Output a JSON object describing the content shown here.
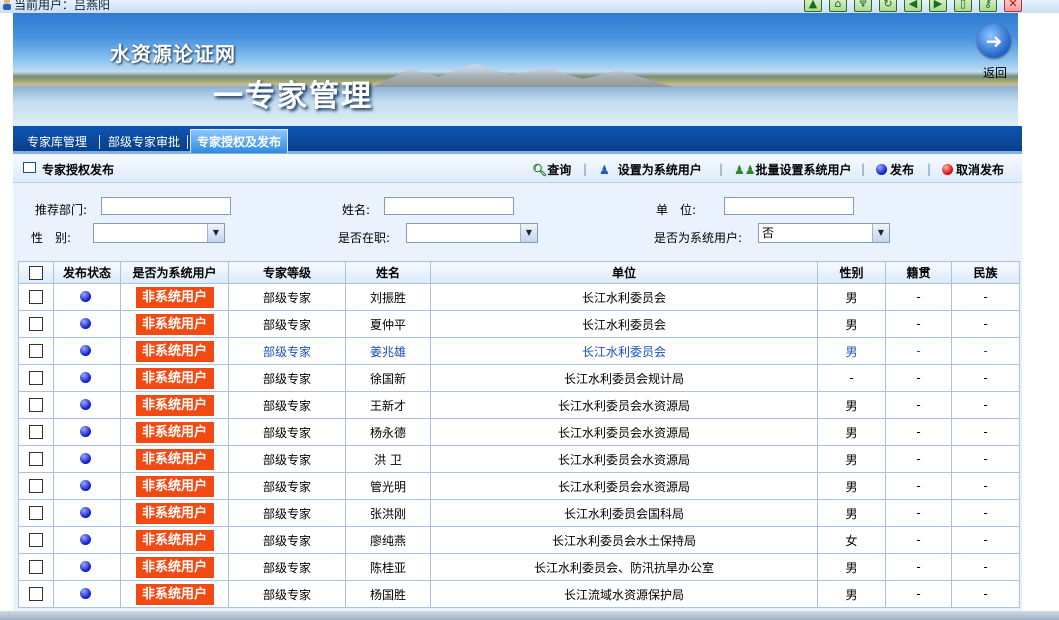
{
  "header": {
    "current_user": "当前用户：吕燕阳",
    "icons": [
      "up-arrow-icon",
      "home-icon",
      "tree-icon",
      "refresh-icon",
      "back-arrow-icon",
      "forward-arrow-icon",
      "exit-icon",
      "key-icon",
      "close-icon"
    ]
  },
  "banner": {
    "title1": "水资源论证网",
    "title2": "一专家管理",
    "back_label": "返回"
  },
  "tabs": [
    {
      "label": "专家库管理"
    },
    {
      "label": "部级专家审批"
    },
    {
      "label": "专家授权及发布"
    }
  ],
  "toolbar": {
    "title": "专家授权发布",
    "query": "查询",
    "set_system_user": "设置为系统用户",
    "batch_set": "批量设置系统用户",
    "publish": "发布",
    "unpublish": "取消发布"
  },
  "filters": {
    "dept_label": "推荐部门:",
    "name_label": "姓名:",
    "unit_label": "单　位:",
    "gender_label": "性　别:",
    "on_duty_label": "是否在职:",
    "is_system_user_label": "是否为系统用户:",
    "is_system_user_value": "否"
  },
  "table": {
    "headers": [
      "发布状态",
      "是否为系统用户",
      "专家等级",
      "姓名",
      "单位",
      "性别",
      "籍贯",
      "民族"
    ],
    "rows": [
      {
        "user": "非系统用户",
        "level": "部级专家",
        "name": "刘振胜",
        "unit": "长江水利委员会",
        "gender": "男",
        "origin": "-",
        "ethnic": "-"
      },
      {
        "user": "非系统用户",
        "level": "部级专家",
        "name": "夏仲平",
        "unit": "长江水利委员会",
        "gender": "男",
        "origin": "-",
        "ethnic": "-"
      },
      {
        "user": "非系统用户",
        "level": "部级专家",
        "name": "姜兆雄",
        "unit": "长江水利委员会",
        "gender": "男",
        "origin": "-",
        "ethnic": "-"
      },
      {
        "user": "非系统用户",
        "level": "部级专家",
        "name": "徐国新",
        "unit": "长江水利委员会规计局",
        "gender": "-",
        "origin": "-",
        "ethnic": "-"
      },
      {
        "user": "非系统用户",
        "level": "部级专家",
        "name": "王新才",
        "unit": "长江水利委员会水资源局",
        "gender": "男",
        "origin": "-",
        "ethnic": "-"
      },
      {
        "user": "非系统用户",
        "level": "部级专家",
        "name": "杨永德",
        "unit": "长江水利委员会水资源局",
        "gender": "男",
        "origin": "-",
        "ethnic": "-"
      },
      {
        "user": "非系统用户",
        "level": "部级专家",
        "name": "洪 卫",
        "unit": "长江水利委员会水资源局",
        "gender": "男",
        "origin": "-",
        "ethnic": "-"
      },
      {
        "user": "非系统用户",
        "level": "部级专家",
        "name": "管光明",
        "unit": "长江水利委员会水资源局",
        "gender": "男",
        "origin": "-",
        "ethnic": "-"
      },
      {
        "user": "非系统用户",
        "level": "部级专家",
        "name": "张洪刚",
        "unit": "长江水利委员会国科局",
        "gender": "男",
        "origin": "-",
        "ethnic": "-"
      },
      {
        "user": "非系统用户",
        "level": "部级专家",
        "name": "廖纯燕",
        "unit": "长江水利委员会水土保持局",
        "gender": "女",
        "origin": "-",
        "ethnic": "-"
      },
      {
        "user": "非系统用户",
        "level": "部级专家",
        "name": "陈桂亚",
        "unit": "长江水利委员会、防汛抗旱办公室",
        "gender": "男",
        "origin": "-",
        "ethnic": "-"
      },
      {
        "user": "非系统用户",
        "level": "部级专家",
        "name": "杨国胜",
        "unit": "长江流域水资源保护局",
        "gender": "男",
        "origin": "-",
        "ethnic": "-"
      }
    ]
  }
}
